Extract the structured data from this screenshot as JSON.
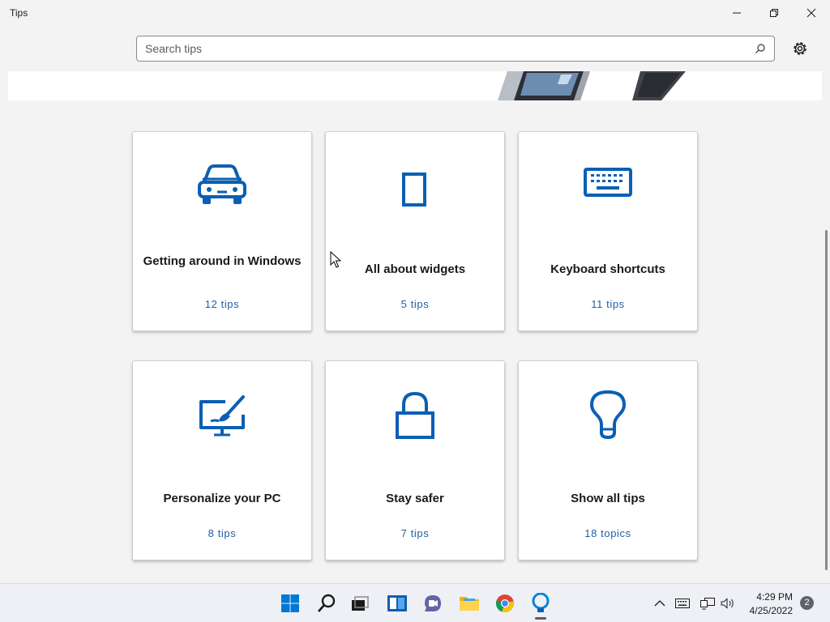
{
  "window": {
    "title": "Tips",
    "minimize_icon": "minimize-icon",
    "restore_icon": "restore-icon",
    "close_icon": "close-icon"
  },
  "search": {
    "placeholder": "Search tips",
    "value": "",
    "icon": "search-icon"
  },
  "settings": {
    "icon": "gear-icon"
  },
  "accent_color": "#1f5ea8",
  "icon_color": "#0a5fb4",
  "cards": [
    {
      "title": "Getting around in Windows",
      "count": "12 tips",
      "icon": "car-icon"
    },
    {
      "title": "All about widgets",
      "count": "5 tips",
      "icon": "widget-icon"
    },
    {
      "title": "Keyboard shortcuts",
      "count": "11 tips",
      "icon": "keyboard-icon"
    },
    {
      "title": "Personalize your PC",
      "count": "8 tips",
      "icon": "paintbrush-monitor-icon"
    },
    {
      "title": "Stay safer",
      "count": "7 tips",
      "icon": "lock-icon"
    },
    {
      "title": "Show all tips",
      "count": "18 topics",
      "icon": "lightbulb-icon"
    }
  ],
  "taskbar": {
    "apps": [
      {
        "icon": "windows-start-icon"
      },
      {
        "icon": "search-icon"
      },
      {
        "icon": "task-view-icon"
      },
      {
        "icon": "widgets-icon"
      },
      {
        "icon": "chat-icon"
      },
      {
        "icon": "file-explorer-icon"
      },
      {
        "icon": "chrome-icon"
      },
      {
        "icon": "tips-app-icon"
      }
    ],
    "tray": [
      {
        "icon": "chevron-up-icon"
      },
      {
        "icon": "keyboard-icon"
      },
      {
        "icon": "network-icon"
      },
      {
        "icon": "volume-icon"
      }
    ],
    "time": "4:29 PM",
    "date": "4/25/2022",
    "notifications": "2"
  }
}
